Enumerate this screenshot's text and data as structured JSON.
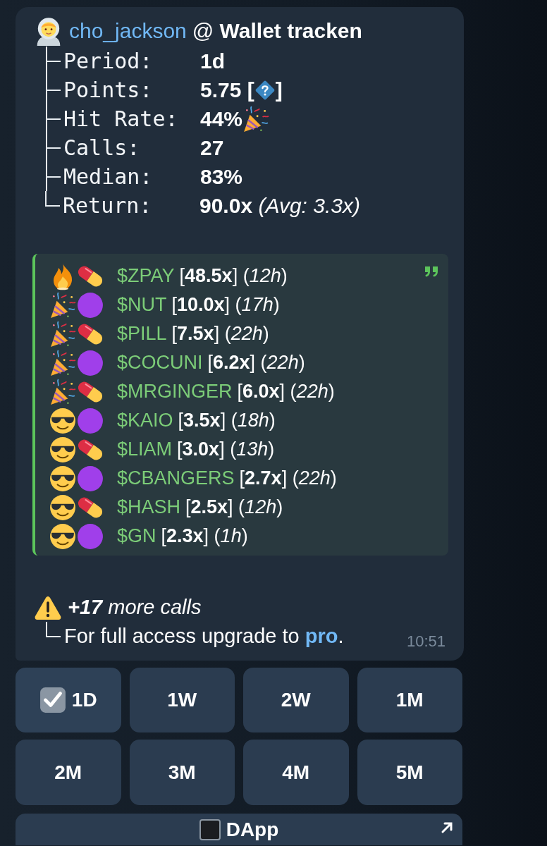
{
  "message": {
    "author": {
      "name": "cho_jackson",
      "title": "@ **Wallet tracken**"
    },
    "stats": [
      {
        "kind": "plain",
        "label": "Period:",
        "value": "1d"
      },
      {
        "kind": "help",
        "label": "Points:",
        "value": "5.75 [",
        "after": "]"
      },
      {
        "kind": "party",
        "label": "Hit Rate:",
        "value": "44%"
      },
      {
        "kind": "plain",
        "label": "Calls:",
        "value": "27"
      },
      {
        "kind": "plain",
        "label": "Median:",
        "value": "83%"
      },
      {
        "kind": "plain",
        "label": "Return:",
        "value": "90.0x *(Avg: 3.3x)*"
      }
    ],
    "calls": [
      {
        "icons": [
          {
            "kind": "fire"
          },
          {
            "kind": "pill"
          }
        ],
        "ticker": "$ZPAY",
        "result": "[**48.5x**] (*12h*)"
      },
      {
        "icons": [
          {
            "kind": "party"
          },
          {
            "kind": "orb"
          }
        ],
        "ticker": "$NUT",
        "result": "[**10.0x**] (*17h*)"
      },
      {
        "icons": [
          {
            "kind": "party"
          },
          {
            "kind": "pill"
          }
        ],
        "ticker": "$PILL",
        "result": "[**7.5x**] (*22h*)"
      },
      {
        "icons": [
          {
            "kind": "party"
          },
          {
            "kind": "orb"
          }
        ],
        "ticker": "$COCUNI",
        "result": "[**6.2x**] (*22h*)"
      },
      {
        "icons": [
          {
            "kind": "party"
          },
          {
            "kind": "pill"
          }
        ],
        "ticker": "$MRGINGER",
        "result": "[**6.0x**] (*22h*)"
      },
      {
        "icons": [
          {
            "kind": "cool"
          },
          {
            "kind": "orb"
          }
        ],
        "ticker": "$KAIO",
        "result": "[**3.5x**] (*18h*)"
      },
      {
        "icons": [
          {
            "kind": "cool"
          },
          {
            "kind": "pill"
          }
        ],
        "ticker": "$LIAM",
        "result": "[**3.0x**] (*13h*)"
      },
      {
        "icons": [
          {
            "kind": "cool"
          },
          {
            "kind": "orb"
          }
        ],
        "ticker": "$CBANGERS",
        "result": "[**2.7x**] (*22h*)"
      },
      {
        "icons": [
          {
            "kind": "cool"
          },
          {
            "kind": "pill"
          }
        ],
        "ticker": "$HASH",
        "result": "[**2.5x**] (*12h*)"
      },
      {
        "icons": [
          {
            "kind": "cool"
          },
          {
            "kind": "orb"
          }
        ],
        "ticker": "$GN",
        "result": "[**2.3x**] (*1h*)"
      }
    ],
    "more": "**+17** more calls",
    "upgrade": {
      "text": "For full access upgrade to ",
      "link": "pro",
      "end": "."
    },
    "time": "10:51"
  },
  "buttons": [
    {
      "label": "1D",
      "selected": true
    },
    {
      "label": "1W",
      "selected": false
    },
    {
      "label": "2W",
      "selected": false
    },
    {
      "label": "1M",
      "selected": false
    },
    {
      "label": "2M",
      "selected": false
    },
    {
      "label": "3M",
      "selected": false
    },
    {
      "label": "4M",
      "selected": false
    },
    {
      "label": "5M",
      "selected": false
    }
  ],
  "app_button": {
    "label": "DApp"
  }
}
